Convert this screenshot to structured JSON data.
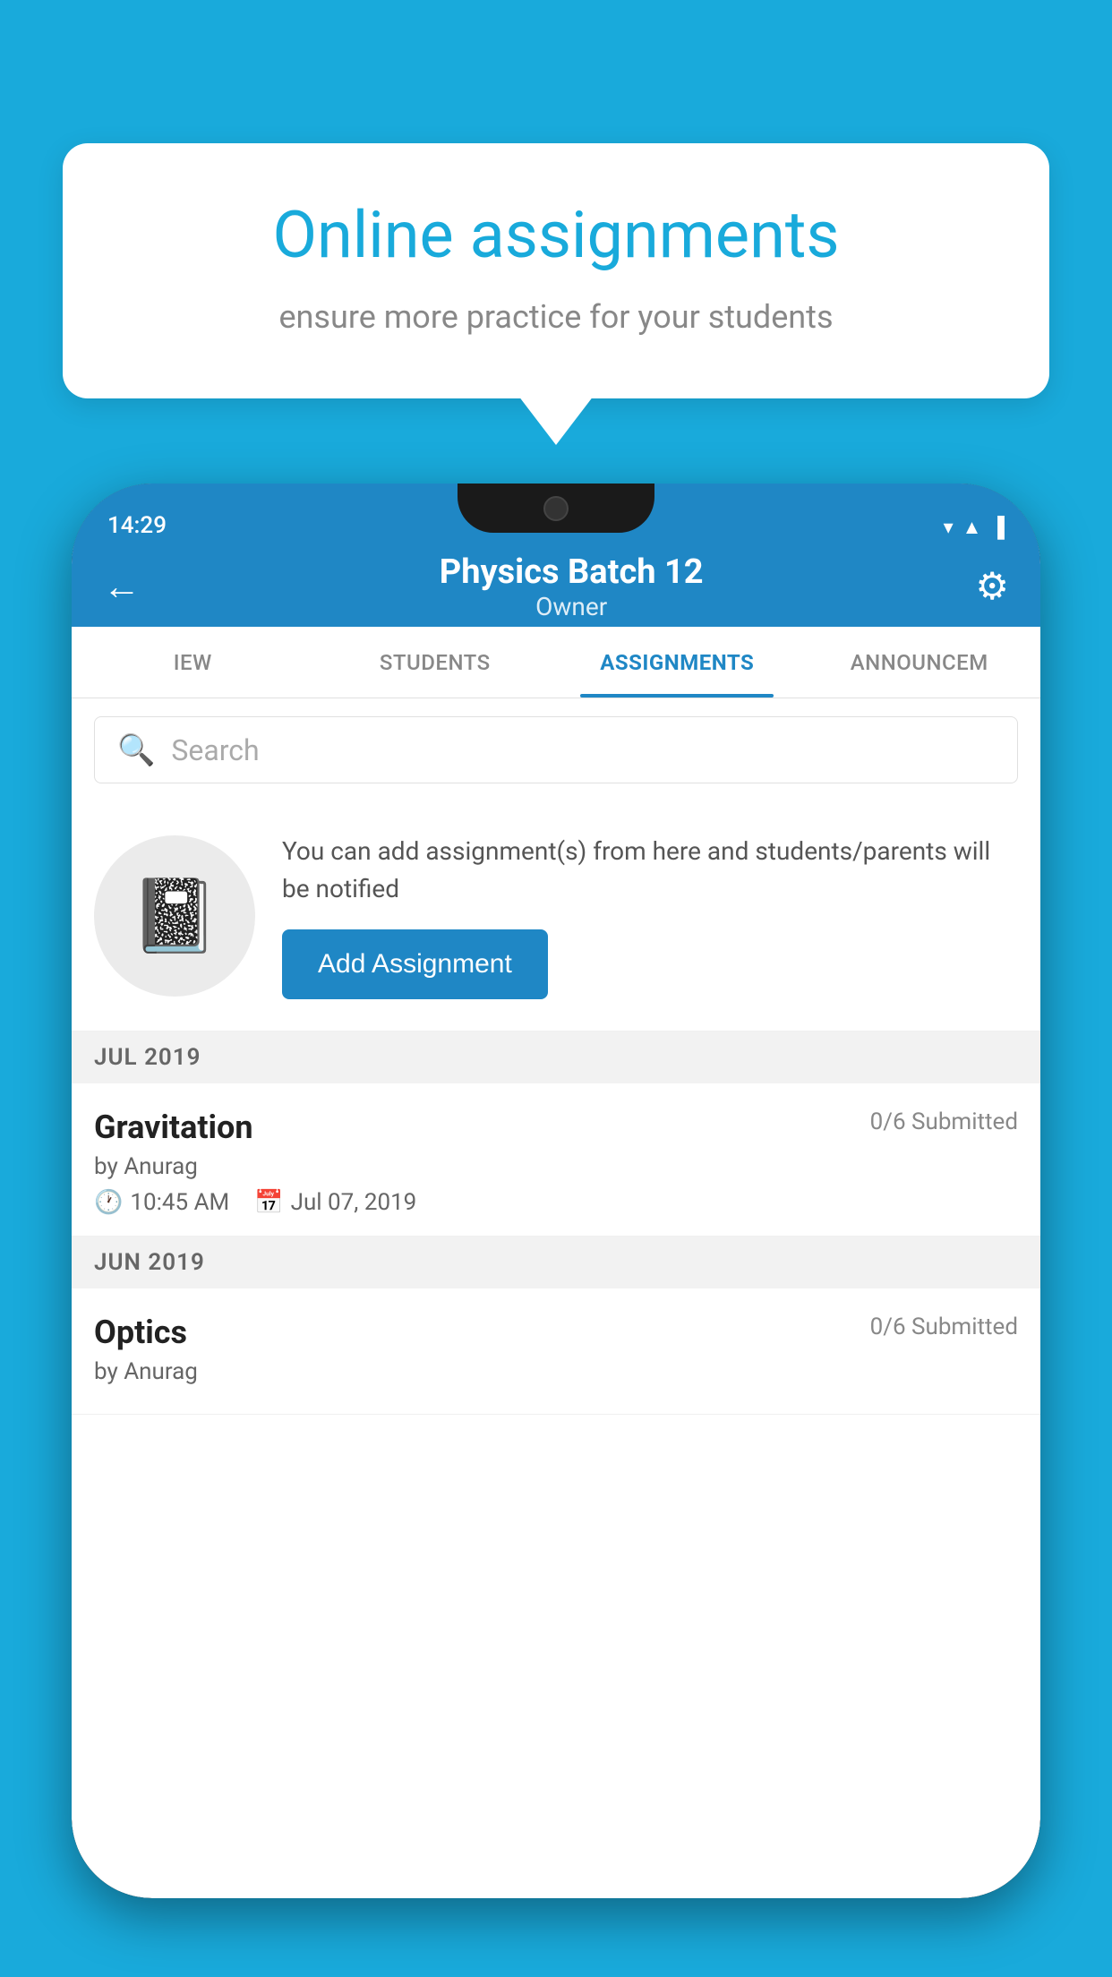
{
  "background": {
    "color": "#19AADB"
  },
  "speech_bubble": {
    "title": "Online assignments",
    "subtitle": "ensure more practice for your students"
  },
  "phone": {
    "status_bar": {
      "time": "14:29",
      "signal_icons": "▲◀▐"
    },
    "top_bar": {
      "title": "Physics Batch 12",
      "subtitle": "Owner",
      "back_label": "←",
      "settings_label": "⚙"
    },
    "tabs": [
      {
        "label": "IEW",
        "active": false
      },
      {
        "label": "STUDENTS",
        "active": false
      },
      {
        "label": "ASSIGNMENTS",
        "active": true
      },
      {
        "label": "ANNOUNCEM",
        "active": false
      }
    ],
    "search": {
      "placeholder": "Search"
    },
    "cta": {
      "description": "You can add assignment(s) from here and students/parents will be notified",
      "button_label": "Add Assignment"
    },
    "sections": [
      {
        "month": "JUL 2019",
        "assignments": [
          {
            "name": "Gravitation",
            "submitted": "0/6 Submitted",
            "author": "by Anurag",
            "time": "10:45 AM",
            "date": "Jul 07, 2019"
          }
        ]
      },
      {
        "month": "JUN 2019",
        "assignments": [
          {
            "name": "Optics",
            "submitted": "0/6 Submitted",
            "author": "by Anurag",
            "time": "",
            "date": ""
          }
        ]
      }
    ]
  }
}
